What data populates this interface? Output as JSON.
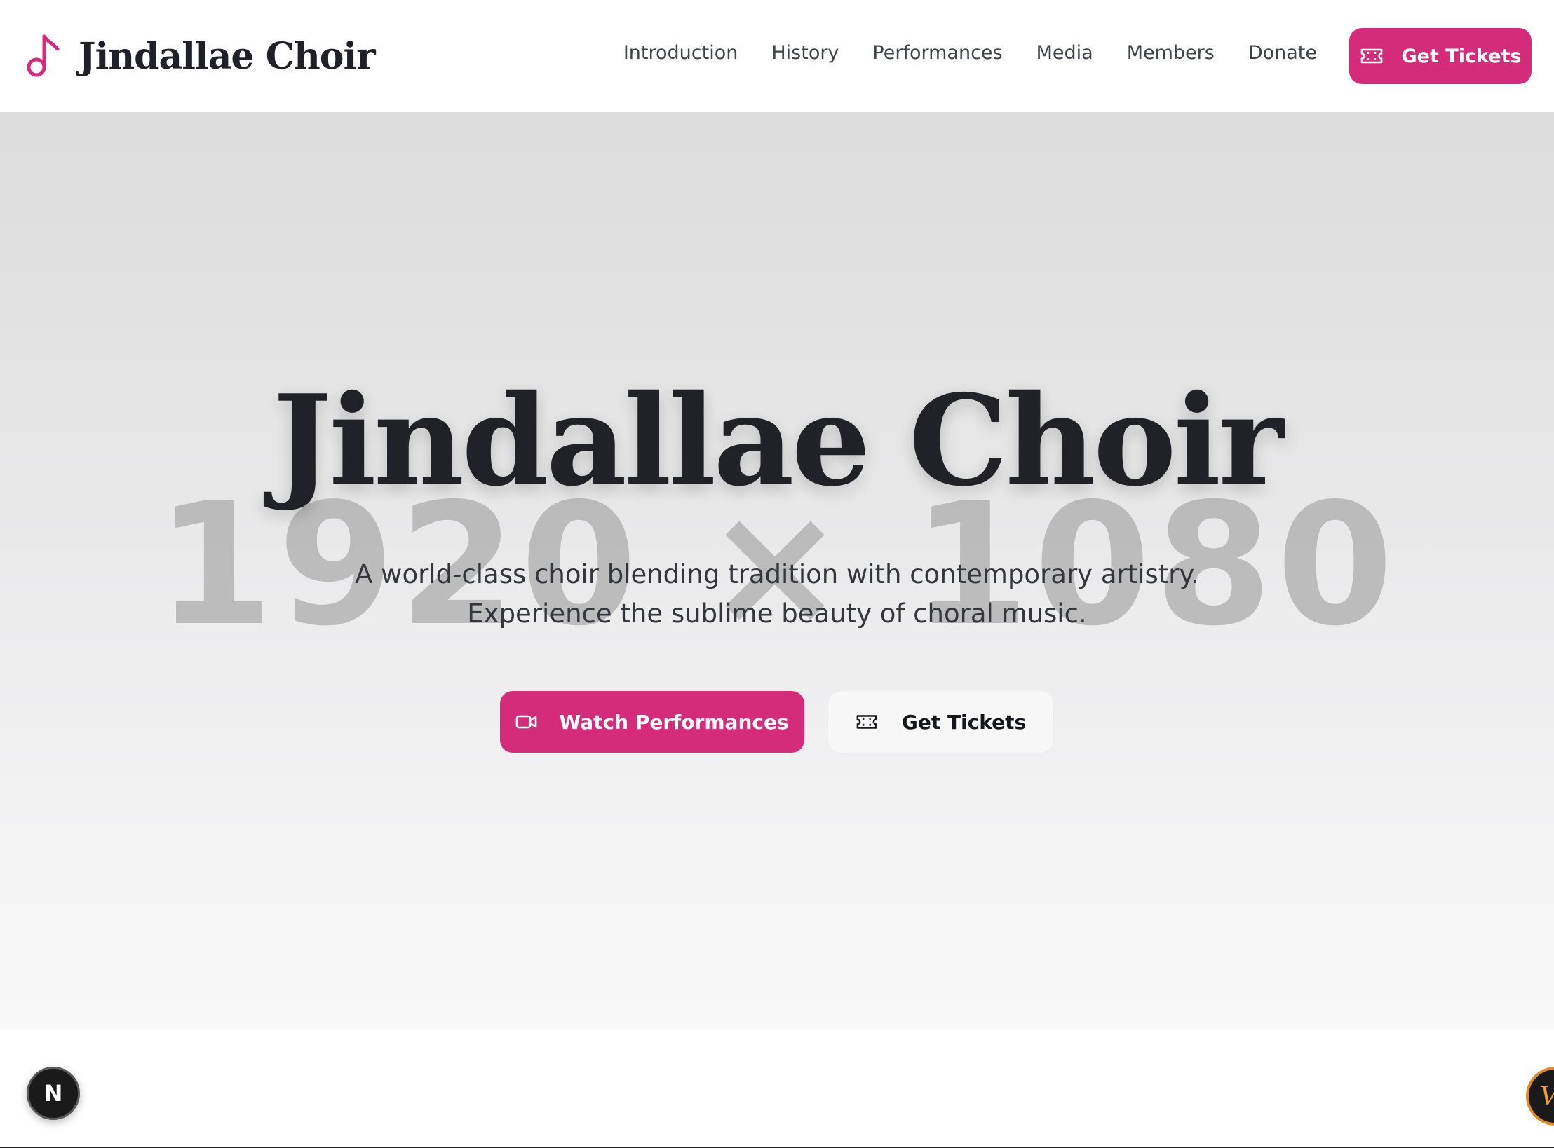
{
  "brand": {
    "name": "Jindallae Choir",
    "icon": "music-note-icon"
  },
  "nav": {
    "items": [
      {
        "label": "Introduction"
      },
      {
        "label": "History"
      },
      {
        "label": "Performances"
      },
      {
        "label": "Media"
      },
      {
        "label": "Members"
      },
      {
        "label": "Donate"
      }
    ],
    "cta": {
      "label": "Get Tickets",
      "icon": "ticket-icon"
    }
  },
  "hero": {
    "title": "Jindallae Choir",
    "placeholder": "1920 × 1080",
    "subtitle": "A world-class choir blending tradition with contemporary artistry. Experience the sublime beauty of choral music.",
    "primary_button": {
      "label": "Watch Performances",
      "icon": "video-icon"
    },
    "secondary_button": {
      "label": "Get Tickets",
      "icon": "ticket-icon"
    }
  },
  "widgets": {
    "nextjs_badge": "N",
    "corner_widget": "V"
  },
  "colors": {
    "accent": "#d42b7a",
    "text_dark": "#212228",
    "nav_text": "#3f434c"
  }
}
